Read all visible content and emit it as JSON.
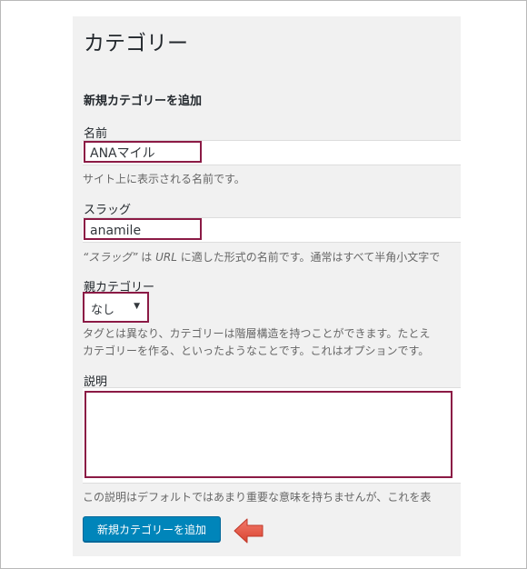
{
  "page": {
    "title": "カテゴリー"
  },
  "form": {
    "section_title": "新規カテゴリーを追加",
    "name": {
      "label": "名前",
      "value": "ANAマイル",
      "help": "サイト上に表示される名前です。"
    },
    "slug": {
      "label": "スラッグ",
      "value": "anamile",
      "help_open_quote": "“",
      "help_term": "スラッグ",
      "help_close_quote": "”",
      "help_mid": " は ",
      "help_url": "URL",
      "help_rest": " に適した形式の名前です。通常はすべて半角小文字で"
    },
    "parent": {
      "label": "親カテゴリー",
      "selected": "なし",
      "help_line1": "タグとは異なり、カテゴリーは階層構造を持つことができます。たとえ",
      "help_line2": "カテゴリーを作る、といったようなことです。これはオプションです。"
    },
    "description": {
      "label": "説明",
      "value": "",
      "help": "この説明はデフォルトではあまり重要な意味を持ちませんが、これを表"
    },
    "submit_label": "新規カテゴリーを追加"
  },
  "colors": {
    "highlight_border": "#8b1a45",
    "button_bg": "#0085ba",
    "arrow_fill": "#e8574a"
  },
  "icons": {
    "dropdown": "triangle-down-icon",
    "pointer": "arrow-left-icon"
  }
}
